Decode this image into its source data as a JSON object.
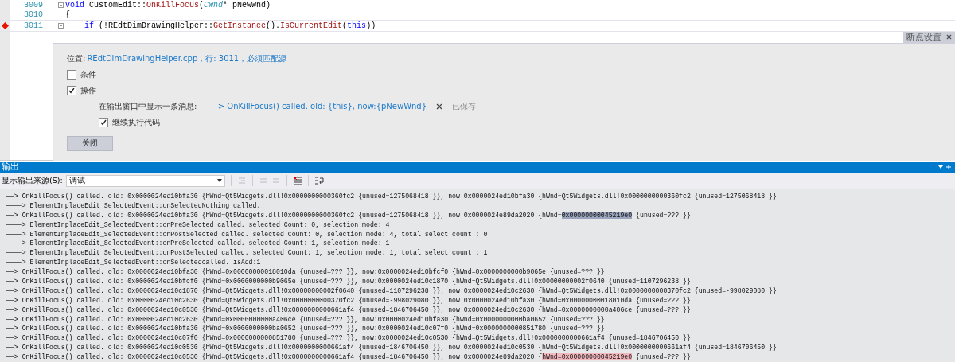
{
  "editor": {
    "lines": [
      {
        "number": "3009",
        "breakpoint": false,
        "foldable": true,
        "current": false,
        "tokens": [
          {
            "text": "void ",
            "kind": "keyword"
          },
          {
            "text": "CustomEdit::",
            "kind": "plain"
          },
          {
            "text": "OnKillFocus",
            "kind": "function"
          },
          {
            "text": "(",
            "kind": "plain"
          },
          {
            "text": "CWnd",
            "kind": "type"
          },
          {
            "text": "* pNewWnd)",
            "kind": "plain"
          }
        ]
      },
      {
        "number": "3010",
        "breakpoint": false,
        "foldable": false,
        "current": false,
        "tokens": [
          {
            "text": "{",
            "kind": "plain"
          }
        ]
      },
      {
        "number": "3011",
        "breakpoint": true,
        "foldable": true,
        "current": true,
        "tokens": [
          {
            "text": "    if ",
            "kind": "keyword"
          },
          {
            "text": "(!REdtDimDrawingHelper::",
            "kind": "plain"
          },
          {
            "text": "GetInstance",
            "kind": "function"
          },
          {
            "text": "().",
            "kind": "plain"
          },
          {
            "text": "IsCurrentEdit",
            "kind": "function"
          },
          {
            "text": "(",
            "kind": "plain"
          },
          {
            "text": "this",
            "kind": "keyword"
          },
          {
            "text": "))",
            "kind": "plain"
          }
        ]
      }
    ]
  },
  "breakpoint_settings": {
    "tab": "断点设置",
    "location_label": "位置:",
    "location": "REdtDimDrawingHelper.cpp，行: 3011，必须匹配源",
    "options": [
      {
        "label": "条件",
        "checked": false
      },
      {
        "label": "操作",
        "checked": true
      }
    ],
    "action": {
      "label": "在输出窗口中显示一条消息:",
      "message": "----> OnKillFocus() called. old: {this}, now:{pNewWnd}",
      "status": "已保存",
      "continue_label": "继续执行代码",
      "continue_checked": true
    },
    "close_button": "关闭"
  },
  "output": {
    "title": "输出",
    "source_label": "显示输出来源(S):",
    "source": "调试",
    "lines": [
      [
        {
          "text": "——> OnKillFocus() called. old: 0x0000024ed10bfa30 {hWnd=Qt5Widgets.dll!0x0000000000360fc2 {unused=1275068418 }}, now:0x0000024ed10bfa30 {hWnd=Qt5Widgets.dll!0x0000000000360fc2 {unused=1275068418 }}",
          "kind": "plain"
        }
      ],
      [
        {
          "text": "————> ElementInplaceEdit_SelectedEvent::onSelectedNothing called.",
          "kind": "plain"
        }
      ],
      [
        {
          "text": "——> OnKillFocus() called. old: 0x0000024ed10bfa30 {hWnd=Qt5Widgets.dll!0x0000000000360fc2 {unused=1275068418 }}, now:0x0000024e89da2020 {hWnd=",
          "kind": "plain"
        },
        {
          "text": "0x00000000045219e0",
          "kind": "selection"
        },
        {
          "text": " {unused=??? }}",
          "kind": "plain"
        }
      ],
      [
        {
          "text": "————> ElementInplaceEdit_SelectedEvent::onPreSelected called. selected Count: 0, selection mode: 4",
          "kind": "plain"
        }
      ],
      [
        {
          "text": "————> ElementInplaceEdit_SelectedEvent::onPostSelected called. selected Count: 0, selection mode: 4, total select count : 0",
          "kind": "plain"
        }
      ],
      [
        {
          "text": "————> ElementInplaceEdit_SelectedEvent::onPreSelected called. selected Count: 1, selection mode: 1",
          "kind": "plain"
        }
      ],
      [
        {
          "text": "————> ElementInplaceEdit_SelectedEvent::onPostSelected called. selected Count: 1, selection mode: 1, total select count : 1",
          "kind": "plain"
        }
      ],
      [
        {
          "text": "————> ElementInplaceEdit_SelectedEvent::onSelectedcalled. isAdd:1",
          "kind": "plain"
        }
      ],
      [
        {
          "text": "——> OnKillFocus() called. old: 0x0000024ed10bfa30 {hWnd=0x00000000018010da {unused=??? }}, now:0x0000024ed10bfcf0 {hWnd=0x0000000000b9065e {unused=??? }}",
          "kind": "plain"
        }
      ],
      [
        {
          "text": "——> OnKillFocus() called. old: 0x0000024ed10bfcf0 {hWnd=0x0000000000b9065e {unused=??? }}, now:0x0000024ed10c1870 {hWnd=Qt5Widgets.dll!0x00000000002f0640 {unused=1107296238 }}",
          "kind": "plain"
        }
      ],
      [
        {
          "text": "——> OnKillFocus() called. old: 0x0000024ed10c1870 {hWnd=Qt5Widgets.dll!0x00000000002f0640 {unused=1107296238 }}, now:0x0000024ed10c2630 {hWnd=Qt5Widgets.dll!0x0000000000370fc2 {unused=-998029080 }}",
          "kind": "plain"
        }
      ],
      [
        {
          "text": "——> OnKillFocus() called. old: 0x0000024ed10c2630 {hWnd=Qt5Widgets.dll!0x0000000000370fc2 {unused=-998029080 }}, now:0x0000024ed10bfa30 {hWnd=0x00000000018010da {unused=??? }}",
          "kind": "plain"
        }
      ],
      [
        {
          "text": "——> OnKillFocus() called. old: 0x0000024ed10c0530 {hWnd=Qt5Widgets.dll!0x0000000000661af4 {unused=1846706450 }}, now:0x0000024ed10c2630 {hWnd=0x0000000000a406ce {unused=??? }}",
          "kind": "plain"
        }
      ],
      [
        {
          "text": "——> OnKillFocus() called. old: 0x0000024ed10c2630 {hWnd=0x0000000000a406ce {unused=??? }}, now:0x0000024ed10bfa30 {hWnd=0x0000000000ba0652 {unused=??? }}",
          "kind": "plain"
        }
      ],
      [
        {
          "text": "——> OnKillFocus() called. old: 0x0000024ed10bfa30 {hWnd=0x0000000000ba0652 {unused=??? }}, now:0x0000024ed10c07f0 {hWnd=0x0000000000851780 {unused=??? }}",
          "kind": "plain"
        }
      ],
      [
        {
          "text": "——> OnKillFocus() called. old: 0x0000024ed10c07f0 {hWnd=0x0000000000851780 {unused=??? }}, now:0x0000024ed10c0530 {hWnd=Qt5Widgets.dll!0x0000000000661af4 {unused=1846706450 }}",
          "kind": "plain"
        }
      ],
      [
        {
          "text": "——> OnKillFocus() called. old: 0x0000024ed10c0530 {hWnd=Qt5Widgets.dll!0x0000000000661af4 {unused=1846706450 }}, now:0x0000024ed10c0530 {hWnd=Qt5Widgets.dll!0x0000000000661af4 {unused=1846706450 }}",
          "kind": "plain"
        }
      ],
      [
        {
          "text": "——> OnKillFocus() called. old: 0x0000024ed10c0530 {hWnd=Qt5Widgets.dll!0x0000000000661af4 {unused=1846706450 }}, now:0x0000024e89da2020 {",
          "kind": "plain"
        },
        {
          "text": "hWnd=0x00000000045219e0",
          "kind": "match"
        },
        {
          "text": " {unused=??? }}",
          "kind": "plain"
        }
      ]
    ]
  }
}
